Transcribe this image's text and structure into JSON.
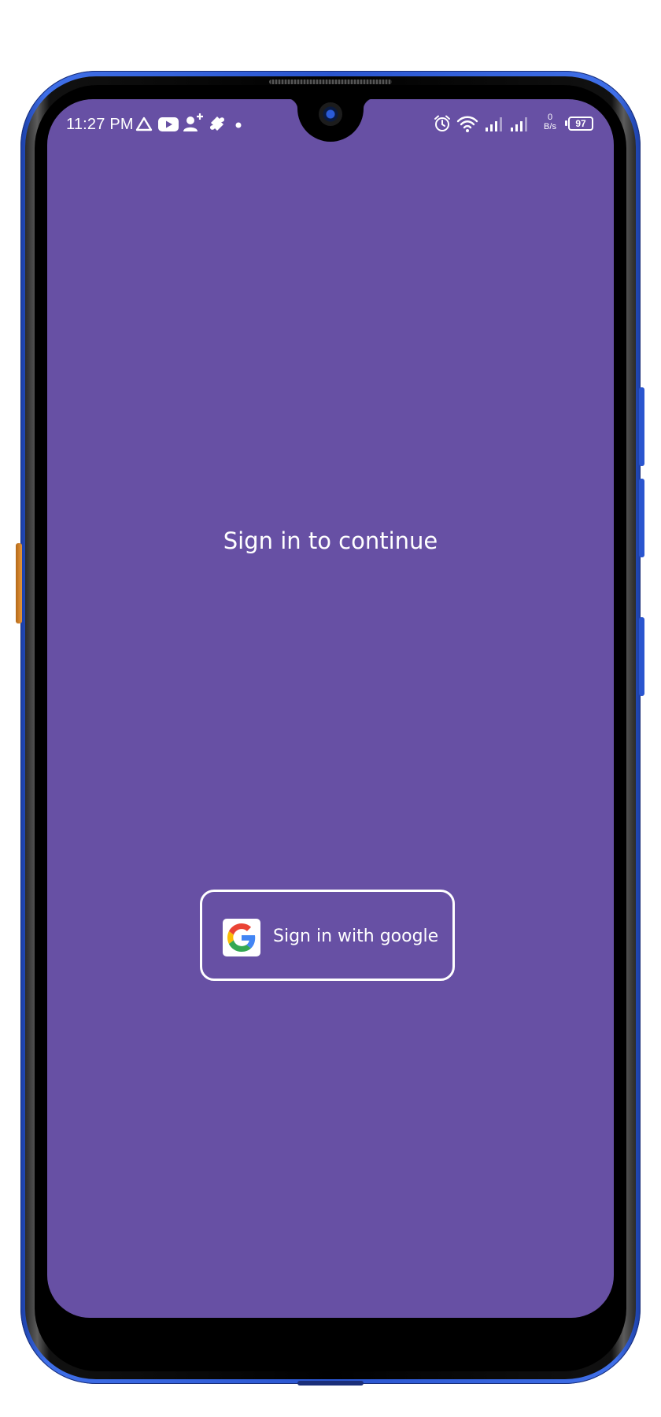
{
  "status_bar": {
    "time": "11:27 PM",
    "net_speed_value": "0",
    "net_speed_unit": "B/s",
    "battery_level": "97",
    "left_icons": [
      "drive-icon",
      "youtube-icon",
      "add-contact-icon",
      "puzzle-icon",
      "dot-icon"
    ],
    "right_icons": [
      "alarm-icon",
      "wifi-icon",
      "signal-icon",
      "signal-icon"
    ]
  },
  "main": {
    "title": "Sign in to continue",
    "google_button_label": "Sign in with google"
  },
  "colors": {
    "background": "#6750a4",
    "text": "#ffffff",
    "button_border": "#ffffff"
  }
}
